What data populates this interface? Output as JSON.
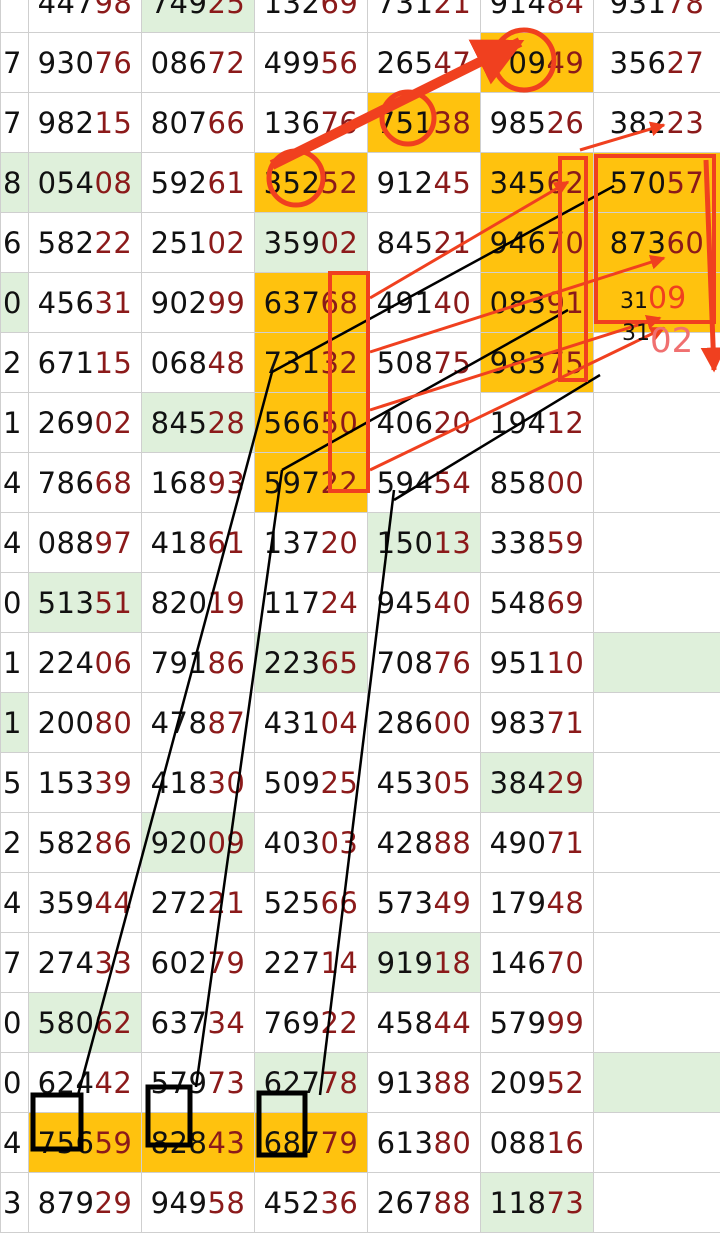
{
  "colors": {
    "green_cell": "#dff0db",
    "yellow_cell": "#ffc20e",
    "head_digits": "#111111",
    "tail_digits": "#8b1a1a",
    "annotation_red": "#f0401f",
    "annotation_black": "#000000"
  },
  "rows": [
    {
      "c0": "",
      "cells": [
        "44798",
        "74925",
        "13269",
        "73121",
        "91484",
        "93178"
      ],
      "hl": [
        "",
        "g",
        "",
        "",
        "",
        ""
      ]
    },
    {
      "c0": "7",
      "cells": [
        "93076",
        "08672",
        "49956",
        "26547",
        "70949",
        "35627"
      ],
      "hl": [
        "",
        "",
        "",
        "",
        "y",
        ""
      ]
    },
    {
      "c0": "7",
      "cells": [
        "98215",
        "80766",
        "13676",
        "75138",
        "98526",
        "38223"
      ],
      "hl": [
        "",
        "",
        "",
        "y",
        "",
        ""
      ]
    },
    {
      "c0": "8",
      "cells": [
        "05408",
        "59261",
        "35252",
        "91245",
        "34562",
        "57057"
      ],
      "hl": [
        "g",
        "",
        "y",
        "",
        "y",
        "y"
      ]
    },
    {
      "c0": "6",
      "cells": [
        "58222",
        "25102",
        "35902",
        "84521",
        "94670",
        "87360"
      ],
      "hl": [
        "",
        "",
        "g",
        "",
        "y",
        "y"
      ]
    },
    {
      "c0": "0",
      "cells": [
        "45631",
        "90299",
        "63768",
        "49140",
        "08391",
        ""
      ],
      "hl": [
        "",
        "",
        "y",
        "",
        "y",
        "y"
      ]
    },
    {
      "c0": "2",
      "cells": [
        "67115",
        "06848",
        "73132",
        "50875",
        "98375",
        ""
      ],
      "hl": [
        "",
        "",
        "y",
        "",
        "y",
        ""
      ]
    },
    {
      "c0": "1",
      "cells": [
        "26902",
        "84528",
        "56650",
        "40620",
        "19412",
        ""
      ],
      "hl": [
        "",
        "g",
        "y",
        "",
        "",
        ""
      ]
    },
    {
      "c0": "4",
      "cells": [
        "78668",
        "16893",
        "59722",
        "59454",
        "85800",
        ""
      ],
      "hl": [
        "",
        "",
        "y",
        "",
        "",
        ""
      ]
    },
    {
      "c0": "4",
      "cells": [
        "08897",
        "41861",
        "13720",
        "15013",
        "33859",
        ""
      ],
      "hl": [
        "",
        "",
        "",
        "g",
        "",
        ""
      ]
    },
    {
      "c0": "0",
      "cells": [
        "51351",
        "82019",
        "11724",
        "94540",
        "54869",
        ""
      ],
      "hl": [
        "g",
        "",
        "",
        "",
        "",
        ""
      ]
    },
    {
      "c0": "1",
      "cells": [
        "22406",
        "79186",
        "22365",
        "70876",
        "95110",
        ""
      ],
      "hl": [
        "",
        "",
        "g",
        "",
        "",
        "g"
      ]
    },
    {
      "c0": "1",
      "cells": [
        "20080",
        "47887",
        "43104",
        "28600",
        "98371",
        ""
      ],
      "hl": [
        "",
        "",
        "",
        "",
        "",
        ""
      ]
    },
    {
      "c0": "5",
      "cells": [
        "15339",
        "41830",
        "50925",
        "45305",
        "38429",
        ""
      ],
      "hl": [
        "",
        "",
        "",
        "",
        "g",
        ""
      ]
    },
    {
      "c0": "2",
      "cells": [
        "58286",
        "92009",
        "40303",
        "42888",
        "49071",
        ""
      ],
      "hl": [
        "",
        "g",
        "",
        "",
        "",
        ""
      ]
    },
    {
      "c0": "4",
      "cells": [
        "35944",
        "27221",
        "52566",
        "57349",
        "17948",
        ""
      ],
      "hl": [
        "",
        "",
        "",
        "",
        "",
        ""
      ]
    },
    {
      "c0": "7",
      "cells": [
        "27433",
        "60279",
        "22714",
        "91918",
        "14670",
        ""
      ],
      "hl": [
        "",
        "",
        "",
        "g",
        "",
        ""
      ]
    },
    {
      "c0": "0",
      "cells": [
        "58062",
        "63734",
        "76922",
        "45844",
        "57999",
        ""
      ],
      "hl": [
        "g",
        "",
        "",
        "",
        "",
        ""
      ]
    },
    {
      "c0": "0",
      "cells": [
        "62442",
        "57973",
        "62778",
        "91388",
        "20952",
        ""
      ],
      "hl": [
        "",
        "",
        "g",
        "",
        "",
        "g"
      ]
    },
    {
      "c0": "4",
      "cells": [
        "75659",
        "82843",
        "68779",
        "61380",
        "08816",
        ""
      ],
      "hl": [
        "y",
        "y",
        "y",
        "",
        "",
        ""
      ]
    },
    {
      "c0": "3",
      "cells": [
        "87929",
        "94958",
        "45236",
        "26788",
        "11873",
        ""
      ],
      "hl": [
        "",
        "",
        "",
        "",
        "g",
        ""
      ]
    }
  ],
  "annotations": {
    "note_1": "31",
    "note_1_red": "09",
    "note_2": "31",
    "note_2_red": "02"
  }
}
